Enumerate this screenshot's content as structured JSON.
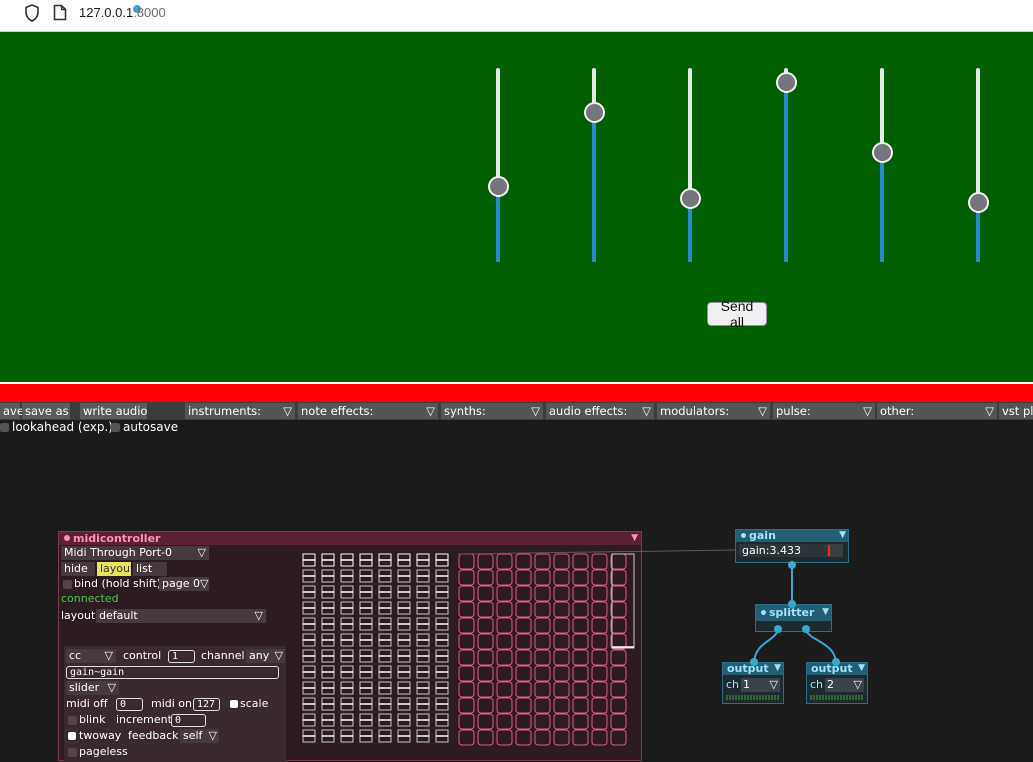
{
  "browser": {
    "url_host": "127.0.0.1",
    "url_port": ":8000"
  },
  "sliders": [
    {
      "level": 0.41
    },
    {
      "level": 0.83
    },
    {
      "level": 0.34
    },
    {
      "level": 1.0
    },
    {
      "level": 0.6
    },
    {
      "level": 0.32
    }
  ],
  "send_all_label": "Send all",
  "toolbar": {
    "save": "ave",
    "save_as": "save as",
    "write_audio": "write audio",
    "dropdowns": [
      "instruments:",
      "note effects:",
      "synths:",
      "audio effects:",
      "modulators:",
      "pulse:",
      "other:",
      "vst plu"
    ],
    "arrow": "▽",
    "lookahead": "lookahead (exp.)",
    "autosave": "autosave"
  },
  "midicontroller": {
    "title": "midicontroller",
    "device": "Midi Through Port-0",
    "hide": "hide",
    "layout_btn": "layout",
    "list_btn": "list",
    "bind": "bind (hold shift)",
    "page": "page 0",
    "connected": "connected",
    "layout_label": "layout",
    "layout_value": "default",
    "cc": "cc",
    "control_label": "control",
    "control_value": "1",
    "channel_label": "channel",
    "channel_value": "any",
    "target": "gain~gain",
    "type": "slider",
    "midi_off_label": "midi off",
    "midi_off_value": "0",
    "midi_on_label": "midi on",
    "midi_on_value": "127",
    "scale": "scale",
    "blink": "blink",
    "increment_label": "increment",
    "increment_value": "0",
    "twoway": "twoway",
    "feedback_label": "feedback",
    "feedback_value": "self",
    "pageless": "pageless",
    "grid_columns": 8,
    "grid_rows": 12,
    "pad_columns": 9,
    "pad_rows": 12
  },
  "nodes": {
    "gain": {
      "title": "gain",
      "value": "gain:3.433"
    },
    "splitter": {
      "title": "splitter"
    },
    "output1": {
      "title": "output",
      "ch_label": "ch",
      "ch_value": "1"
    },
    "output2": {
      "title": "output",
      "ch_label": "ch",
      "ch_value": "2"
    }
  },
  "colors": {
    "stage": "#006000",
    "slider_fill": "#2b88d8",
    "bar": "#ff0000",
    "node_accent": "#39a8cc",
    "midi_accent": "#e8588a"
  }
}
